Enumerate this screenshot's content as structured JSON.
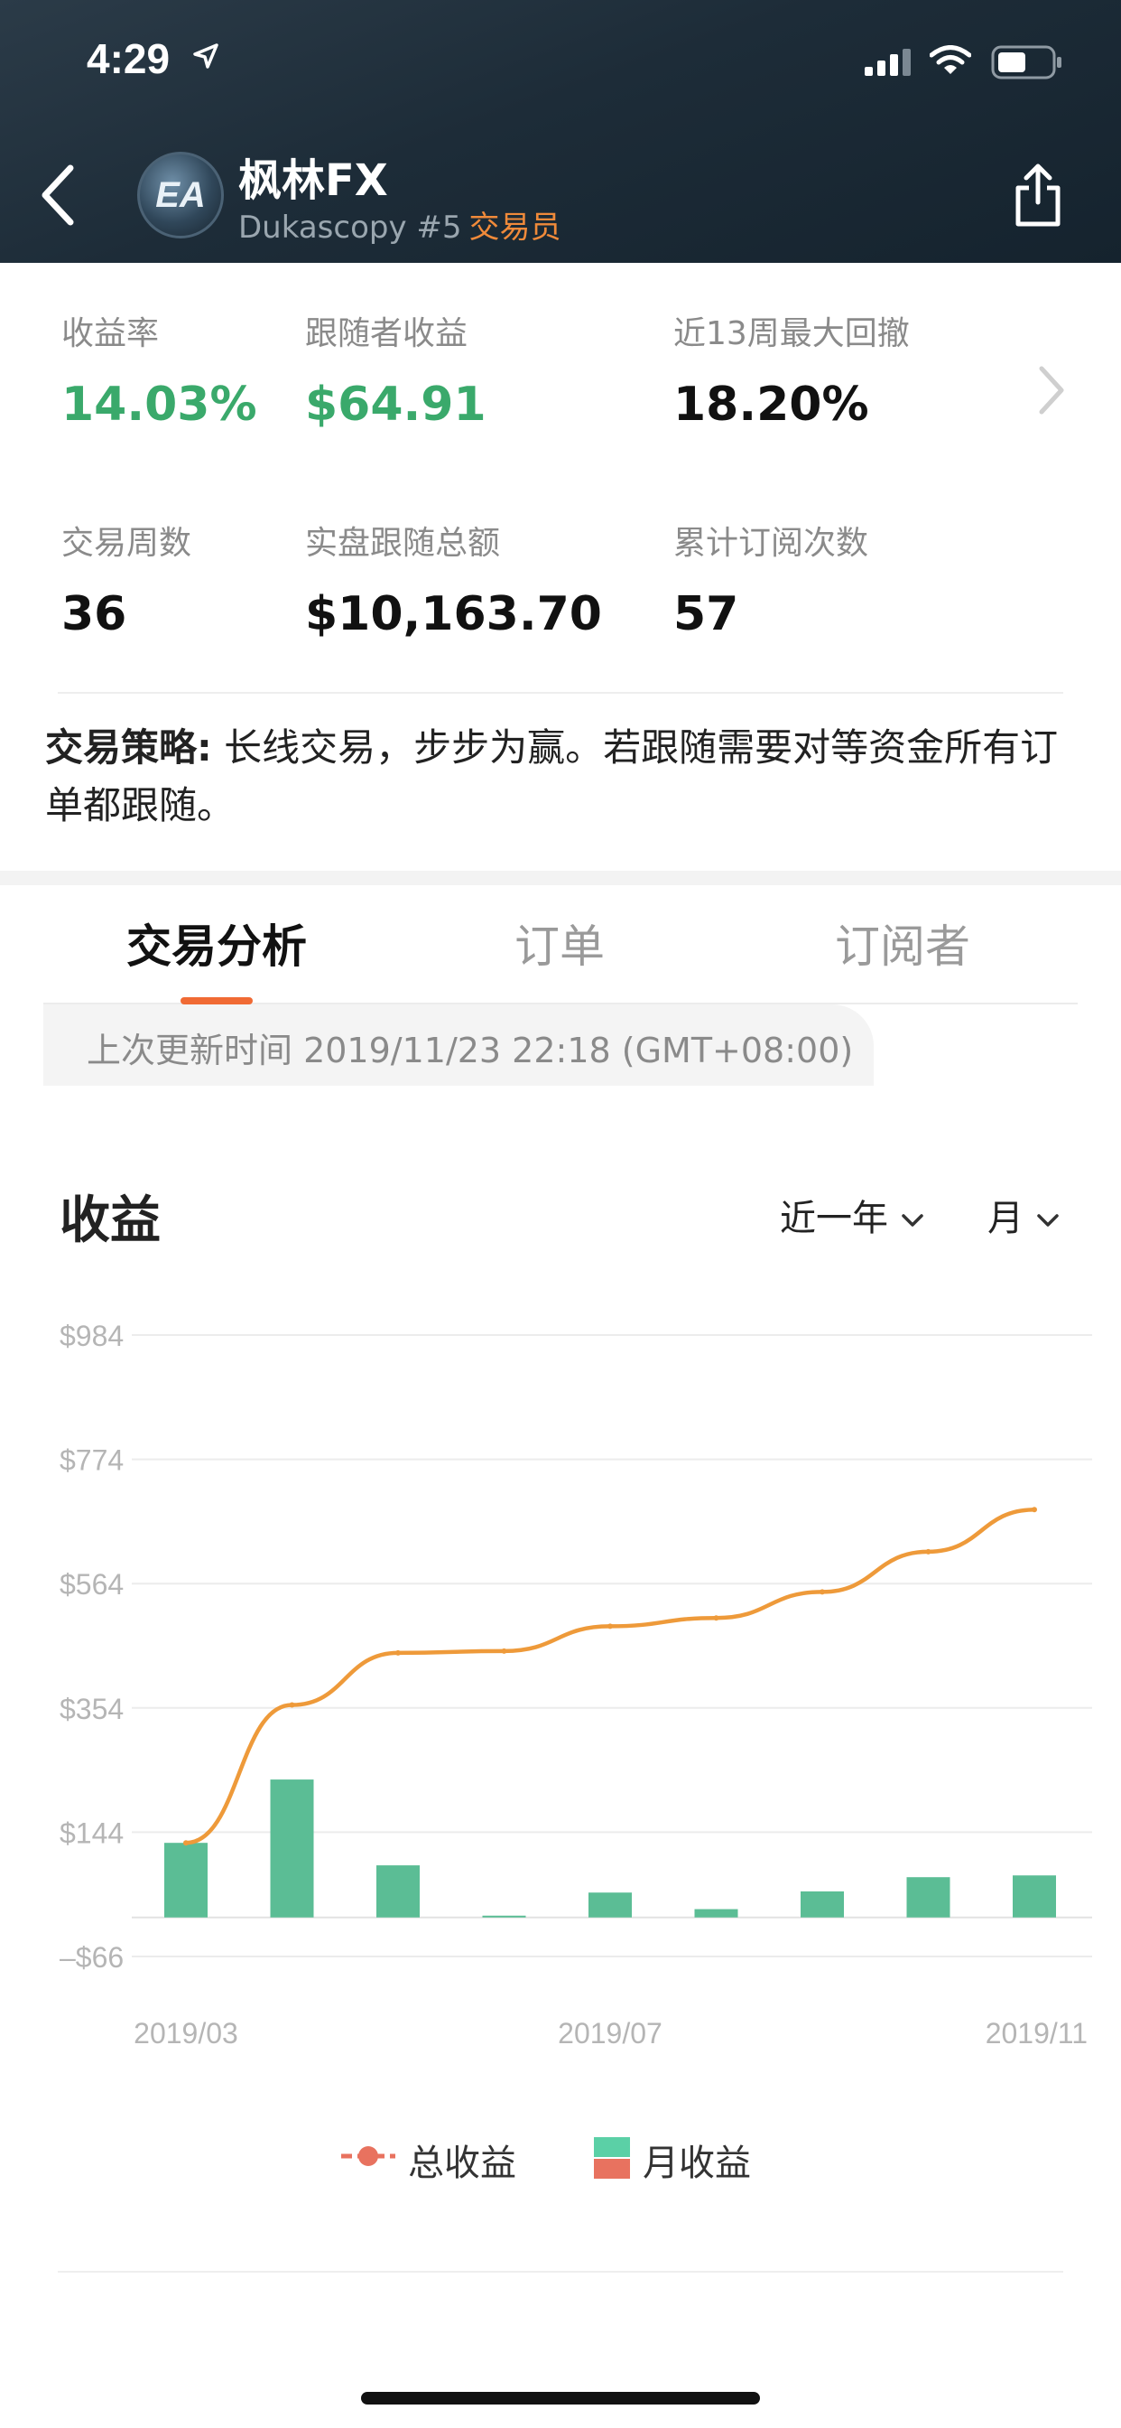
{
  "status_bar": {
    "time": "4:29"
  },
  "header": {
    "avatar_text": "EA",
    "name": "枫林FX",
    "subtitle": "Dukascopy #5",
    "role": "交易员"
  },
  "stats": [
    {
      "label": "收益率",
      "value": "14.03%",
      "color": "#3aa96b"
    },
    {
      "label": "跟随者收益",
      "value": "$64.91",
      "color": "#3aa96b"
    },
    {
      "label": "近13周最大回撤",
      "value": "18.20%",
      "color": "#111111"
    },
    {
      "label": "交易周数",
      "value": "36",
      "color": "#111111"
    },
    {
      "label": "实盘跟随总额",
      "value": "$10,163.70",
      "color": "#111111"
    },
    {
      "label": "累计订阅次数",
      "value": "57",
      "color": "#111111"
    }
  ],
  "strategy": {
    "label": "交易策略:",
    "text": " 长线交易，步步为赢。若跟随需要对等资金所有订单都跟随。"
  },
  "tabs": [
    {
      "label": "交易分析",
      "active": true
    },
    {
      "label": "订单",
      "active": false
    },
    {
      "label": "订阅者",
      "active": false
    }
  ],
  "update_text": "上次更新时间 2019/11/23 22:18 (GMT+08:00)",
  "chart_header": {
    "title": "收益",
    "range_select": "近一年",
    "period_select": "月"
  },
  "legend": {
    "line_label": "总收益",
    "bar_label": "月收益"
  },
  "colors": {
    "accent": "#f06a34",
    "line": "#ee9a3a",
    "bar": "#5bbd95",
    "bar_negative": "#e8725f",
    "green_text": "#3aa96b"
  },
  "chart_data": {
    "type": "bar",
    "title": "",
    "y_ticks": [
      "$984",
      "$774",
      "$564",
      "$354",
      "$144",
      "–$66"
    ],
    "ylim": [
      -66,
      984
    ],
    "x_tick_labels": [
      "2019/03",
      "2019/07",
      "2019/11"
    ],
    "categories": [
      "2019/03",
      "2019/04",
      "2019/05",
      "2019/06",
      "2019/07",
      "2019/08",
      "2019/09",
      "2019/10",
      "2019/11"
    ],
    "series": [
      {
        "name": "月收益",
        "type": "bar",
        "values": [
          126,
          233,
          88,
          3,
          42,
          14,
          44,
          68,
          71
        ]
      },
      {
        "name": "总收益",
        "type": "line",
        "values": [
          126,
          359,
          447,
          450,
          492,
          506,
          550,
          618,
          689
        ]
      }
    ],
    "grid": true,
    "legend": "bottom"
  }
}
